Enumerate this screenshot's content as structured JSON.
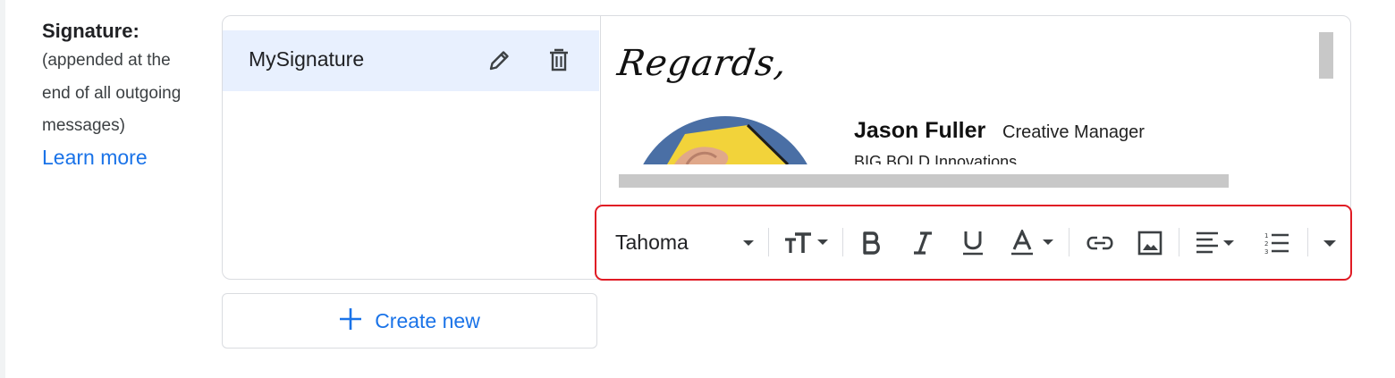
{
  "signature_section": {
    "title": "Signature:",
    "description_lines": [
      "(appended at the",
      "end of all outgoing",
      "messages)"
    ],
    "learn_more": "Learn more"
  },
  "signatures": {
    "items": [
      {
        "name": "MySignature",
        "selected": true
      }
    ],
    "create_new_label": "Create new"
  },
  "preview": {
    "greeting": "Regards,",
    "name": "Jason Fuller",
    "role": "Creative Manager",
    "company": "BIG BOLD Innovations"
  },
  "toolbar": {
    "font_family": "Tahoma",
    "buttons": [
      "font-family-dropdown",
      "font-size-icon",
      "bold-icon",
      "italic-icon",
      "underline-icon",
      "text-color-icon",
      "link-icon",
      "image-icon",
      "align-icon",
      "numbered-list-icon",
      "more-options-icon"
    ]
  },
  "colors": {
    "accent": "#1a73e8",
    "selected_bg": "#e8f0fe",
    "highlight_border": "#e01b24",
    "border": "#dadce0"
  }
}
